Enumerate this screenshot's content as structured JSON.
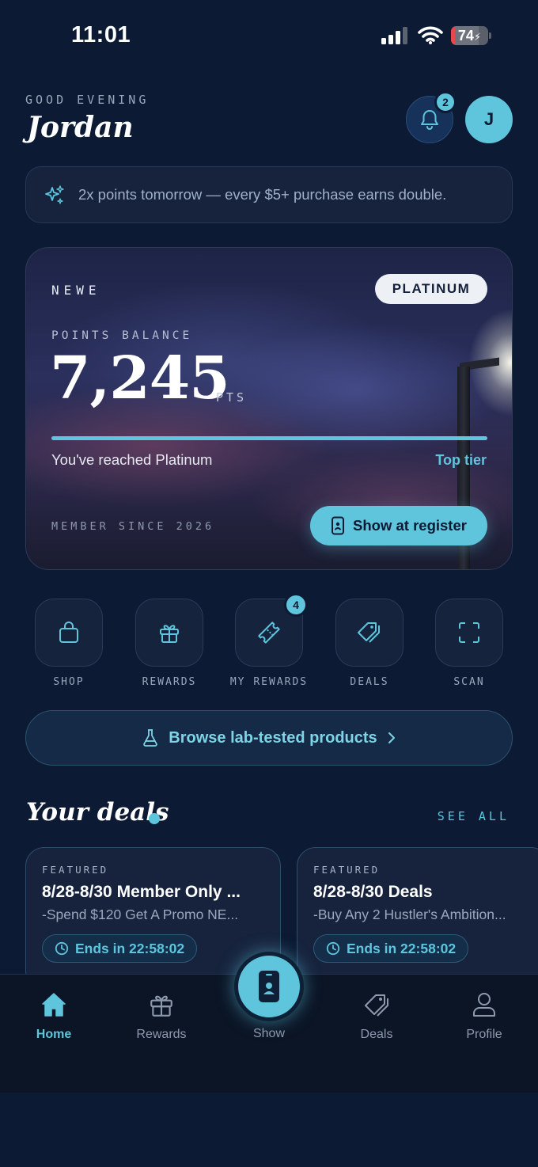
{
  "status_bar": {
    "time": "11:01",
    "battery": "74",
    "battery_level": 0.74
  },
  "header": {
    "greeting": "GOOD EVENING",
    "name": "Jordan",
    "notification_count": "2",
    "avatar_initial": "J"
  },
  "promo": {
    "icon": "sparkles-icon",
    "text": "2x points tomorrow — every $5+ purchase earns double."
  },
  "points_card": {
    "brand": "NEWE",
    "tier": "PLATINUM",
    "balance_label": "POINTS BALANCE",
    "balance": "7,245",
    "unit": "PTS",
    "progress": 1.0,
    "progress_text": "You've reached Platinum",
    "progress_status": "Top tier",
    "member_since": "MEMBER SINCE 2026",
    "register_button": "Show at register"
  },
  "quick_actions": [
    {
      "label": "SHOP",
      "icon": "shopping-bag-icon"
    },
    {
      "label": "REWARDS",
      "icon": "gift-icon"
    },
    {
      "label": "MY REWARDS",
      "icon": "ticket-icon",
      "badge": "4"
    },
    {
      "label": "DEALS",
      "icon": "tags-icon"
    },
    {
      "label": "SCAN",
      "icon": "scan-icon"
    }
  ],
  "browse": {
    "label": "Browse lab-tested products",
    "icon": "flask-icon"
  },
  "deals": {
    "title": "Your deals",
    "see_all": "SEE ALL",
    "items": [
      {
        "tag": "FEATURED",
        "title": "8/28-8/30 Member Only ...",
        "subtitle": "-Spend $120 Get A Promo NE...",
        "ends": "Ends in 22:58:02"
      },
      {
        "tag": "FEATURED",
        "title": "8/28-8/30 Deals",
        "subtitle": "-Buy Any 2 Hustler's Ambition...",
        "ends": "Ends in 22:58:02"
      }
    ]
  },
  "tabbar": {
    "items": [
      {
        "label": "Home",
        "icon": "home-icon",
        "active": true
      },
      {
        "label": "Rewards",
        "icon": "gift-icon"
      },
      {
        "label": "Show",
        "icon": "member-card-icon"
      },
      {
        "label": "Deals",
        "icon": "tag-icon"
      },
      {
        "label": "Profile",
        "icon": "user-icon"
      }
    ]
  },
  "colors": {
    "background": "#0c1a33",
    "accent": "#5ec5dc",
    "card": "#17233d"
  }
}
